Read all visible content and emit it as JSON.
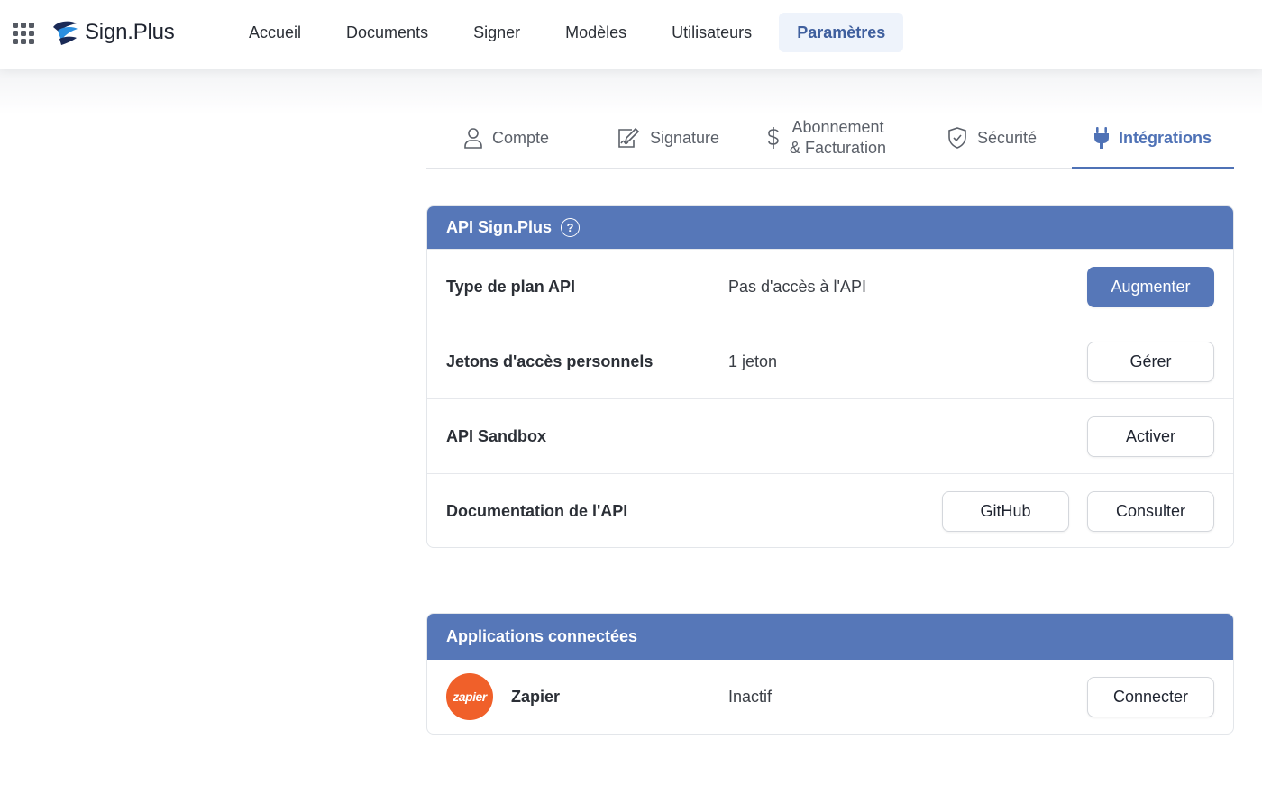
{
  "brand": {
    "name": "Sign.Plus",
    "accent": "#5677b8"
  },
  "nav": {
    "items": [
      {
        "label": "Accueil"
      },
      {
        "label": "Documents"
      },
      {
        "label": "Signer"
      },
      {
        "label": "Modèles"
      },
      {
        "label": "Utilisateurs"
      },
      {
        "label": "Paramètres",
        "active": true
      }
    ]
  },
  "tabs": [
    {
      "label": "Compte",
      "icon": "user-icon"
    },
    {
      "label": "Signature",
      "icon": "signature-icon"
    },
    {
      "label_line1": "Abonnement",
      "label_line2": "& Facturation",
      "icon": "dollar-icon"
    },
    {
      "label": "Sécurité",
      "icon": "shield-icon"
    },
    {
      "label": "Intégrations",
      "icon": "plug-icon",
      "active": true
    }
  ],
  "api_card": {
    "title": "API Sign.Plus",
    "help": "?",
    "rows": [
      {
        "label": "Type de plan API",
        "value": "Pas d'accès à l'API",
        "button": "Augmenter"
      },
      {
        "label": "Jetons d'accès personnels",
        "value": "1 jeton",
        "button": "Gérer"
      },
      {
        "label": "API Sandbox",
        "value": "",
        "button": "Activer"
      },
      {
        "label": "Documentation de l'API",
        "value": "",
        "button_secondary": "GitHub",
        "button": "Consulter"
      }
    ]
  },
  "apps_card": {
    "title": "Applications connectées",
    "rows": [
      {
        "logo_text": "zapier",
        "label": "Zapier",
        "value": "Inactif",
        "button": "Connecter"
      }
    ]
  }
}
